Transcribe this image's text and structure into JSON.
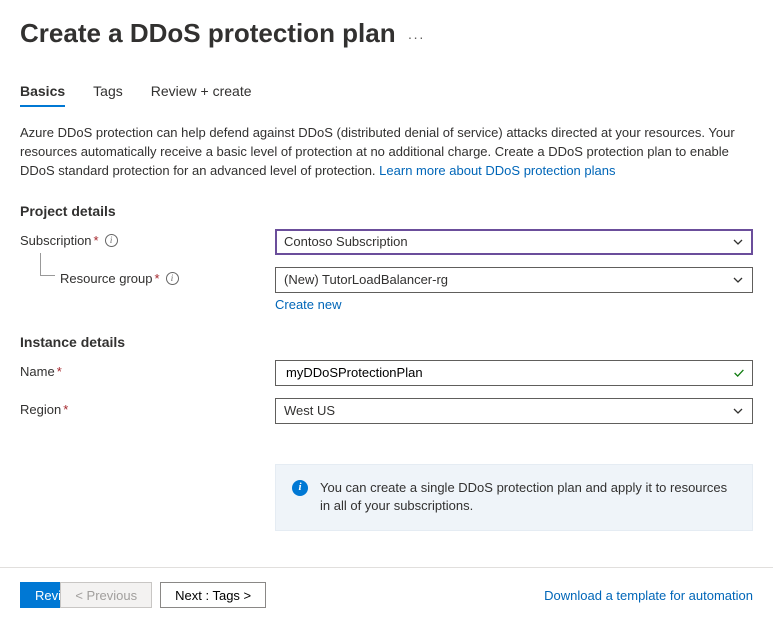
{
  "header": {
    "title": "Create a DDoS protection plan"
  },
  "tabs": {
    "basics": "Basics",
    "tags": "Tags",
    "review": "Review + create"
  },
  "intro": {
    "text": "Azure DDoS protection can help defend against DDoS (distributed denial of service) attacks directed at your resources. Your resources automatically receive a basic level of protection at no additional charge. Create a DDoS protection plan to enable DDoS standard protection for an advanced level of protection.  ",
    "link": "Learn more about DDoS protection plans"
  },
  "project": {
    "heading": "Project details",
    "subscription_label": "Subscription",
    "subscription_value": "Contoso Subscription",
    "rg_label": "Resource group",
    "rg_value": "(New) TutorLoadBalancer-rg",
    "create_new": "Create new"
  },
  "instance": {
    "heading": "Instance details",
    "name_label": "Name",
    "name_value": "myDDoSProtectionPlan",
    "region_label": "Region",
    "region_value": "West US"
  },
  "infobox": {
    "text": "You can create a single DDoS protection plan and apply it to resources in all of your subscriptions."
  },
  "footer": {
    "review": "Review + create",
    "previous": "< Previous",
    "next": "Next : Tags >",
    "download": "Download a template for automation"
  }
}
